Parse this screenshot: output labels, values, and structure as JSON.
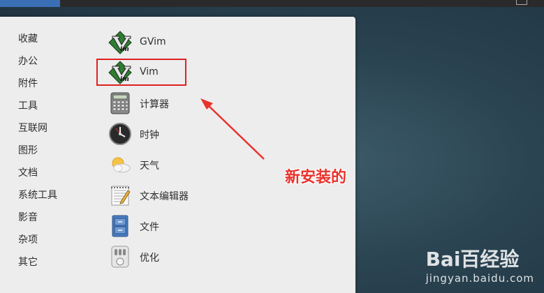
{
  "categories": [
    {
      "label": "收藏"
    },
    {
      "label": "办公"
    },
    {
      "label": "附件"
    },
    {
      "label": "工具"
    },
    {
      "label": "互联网"
    },
    {
      "label": "图形"
    },
    {
      "label": "文档"
    },
    {
      "label": "系统工具"
    },
    {
      "label": "影音"
    },
    {
      "label": "杂项"
    },
    {
      "label": "其它"
    }
  ],
  "apps": [
    {
      "label": "GVim",
      "icon": "gvim-icon"
    },
    {
      "label": "Vim",
      "icon": "vim-icon"
    },
    {
      "label": "计算器",
      "icon": "calculator-icon"
    },
    {
      "label": "时钟",
      "icon": "clock-icon"
    },
    {
      "label": "天气",
      "icon": "weather-icon"
    },
    {
      "label": "文本编辑器",
      "icon": "text-editor-icon"
    },
    {
      "label": "文件",
      "icon": "files-icon"
    },
    {
      "label": "优化",
      "icon": "tweak-icon"
    }
  ],
  "annotation": {
    "text": "新安装的",
    "color": "#e8322c"
  },
  "watermark": {
    "logo": "Bai百经验",
    "site": "jingyan.baidu.com"
  }
}
